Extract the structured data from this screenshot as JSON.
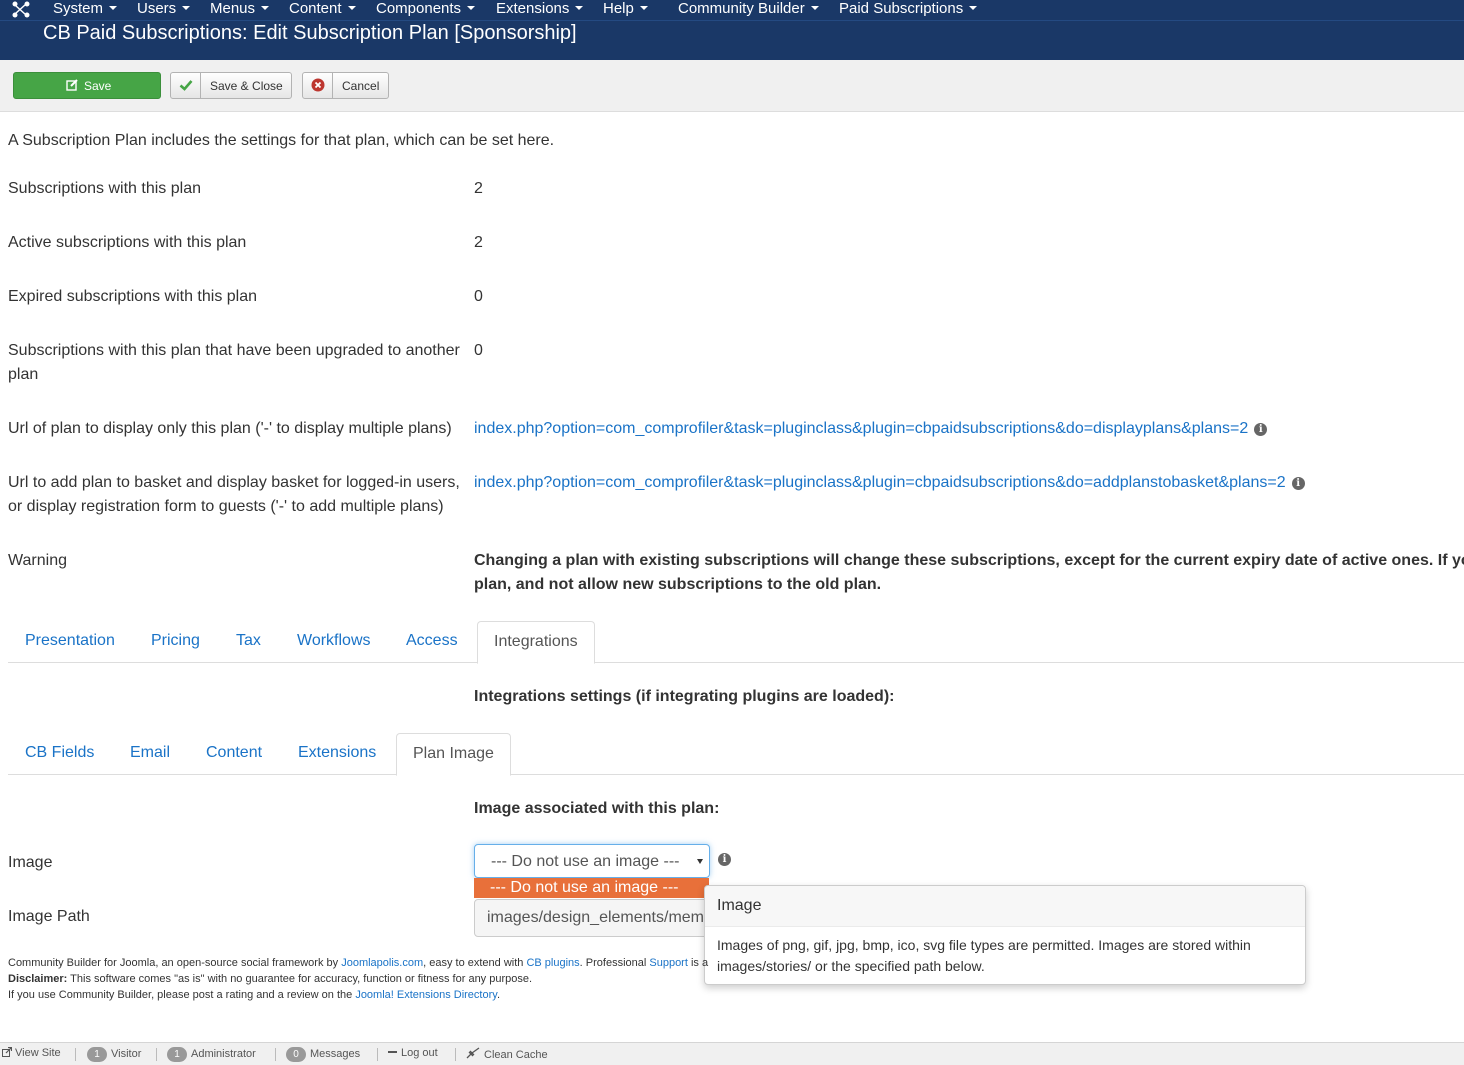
{
  "menu": {
    "items": [
      {
        "label": "System",
        "icon": "chevron-down-icon"
      },
      {
        "label": "Users",
        "icon": "chevron-down-icon"
      },
      {
        "label": "Menus",
        "icon": "chevron-down-icon"
      },
      {
        "label": "Content",
        "icon": "chevron-down-icon"
      },
      {
        "label": "Components",
        "icon": "chevron-down-icon"
      },
      {
        "label": "Extensions",
        "icon": "chevron-down-icon"
      },
      {
        "label": "Help",
        "icon": "chevron-down-icon"
      },
      {
        "label": "Community Builder",
        "icon": "chevron-down-icon"
      },
      {
        "label": "Paid Subscriptions",
        "icon": "chevron-down-icon"
      }
    ],
    "logo_icon": "joomla-logo-icon"
  },
  "page": {
    "title": "CB Paid Subscriptions: Edit Subscription Plan [Sponsorship]"
  },
  "toolbar": {
    "save_label": "Save",
    "save_close_label": "Save & Close",
    "cancel_label": "Cancel",
    "save_color": "#46a546"
  },
  "intro": "A Subscription Plan includes the settings for that plan, which can be set here.",
  "stats": [
    {
      "label": "Subscriptions with this plan",
      "value": "2"
    },
    {
      "label": "Active subscriptions with this plan",
      "value": "2"
    },
    {
      "label": "Expired subscriptions with this plan",
      "value": "0"
    },
    {
      "label": "Subscriptions with this plan that have been upgraded to another plan",
      "value": "0"
    }
  ],
  "urls": [
    {
      "label": "Url of plan to display only this plan ('-' to display multiple plans)",
      "value": "index.php?option=com_comprofiler&task=pluginclass&plugin=cbpaidsubscriptions&do=displayplans&plans=2"
    },
    {
      "label": "Url to add plan to basket and display basket for logged-in users, or display registration form to guests ('-' to add multiple plans)",
      "value": "index.php?option=com_comprofiler&task=pluginclass&plugin=cbpaidsubscriptions&do=addplanstobasket&plans=2"
    }
  ],
  "warning": {
    "label": "Warning",
    "line1": "Changing a plan with existing subscriptions will change these subscriptions, except for the current expiry date of active ones. If yo",
    "line2": "plan, and not allow new subscriptions to the old plan."
  },
  "main_tabs": [
    {
      "label": "Presentation"
    },
    {
      "label": "Pricing"
    },
    {
      "label": "Tax"
    },
    {
      "label": "Workflows"
    },
    {
      "label": "Access"
    },
    {
      "label": "Integrations",
      "active": true
    }
  ],
  "integrations_heading": "Integrations settings (if integrating plugins are loaded):",
  "sub_tabs": [
    {
      "label": "CB Fields"
    },
    {
      "label": "Email"
    },
    {
      "label": "Content"
    },
    {
      "label": "Extensions"
    },
    {
      "label": "Plan Image",
      "active": true
    }
  ],
  "image_heading": "Image associated with this plan:",
  "image_field": {
    "label": "Image",
    "selected": "--- Do not use an image ---",
    "highlighted_option": "--- Do not use an image ---",
    "highlight_color": "#e8703a"
  },
  "image_path": {
    "label": "Image Path",
    "value": "images/design_elements/mem"
  },
  "popover": {
    "title": "Image",
    "body": "Images of png, gif, jpg, bmp, ico, svg file types are permitted. Images are stored within images/stories/ or the specified path below."
  },
  "footer": {
    "line1_pre": "Community Builder for Joomla, an open-source social framework by ",
    "line1_link1": "Joomlapolis.com",
    "line1_mid": ", easy to extend with ",
    "line1_link2": "CB plugins",
    "line1_mid2": ". Professional ",
    "line1_link3": "Support",
    "line1_post": " is a",
    "disclaimer_label": "Disclaimer:",
    "disclaimer_text": " This software comes \"as is\" with no guarantee for accuracy, function or fitness for any purpose.",
    "line3_pre": "If you use Community Builder, please post a rating and a review on the ",
    "line3_link": "Joomla! Extensions Directory",
    "line3_post": "."
  },
  "statusbar": {
    "view_site": "View Site",
    "visitor_count": "1",
    "visitor_label": "Visitor",
    "admin_count": "1",
    "admin_label": "Administrator",
    "messages_count": "0",
    "messages_label": "Messages",
    "logout": "Log out",
    "clean_cache": "Clean Cache"
  }
}
